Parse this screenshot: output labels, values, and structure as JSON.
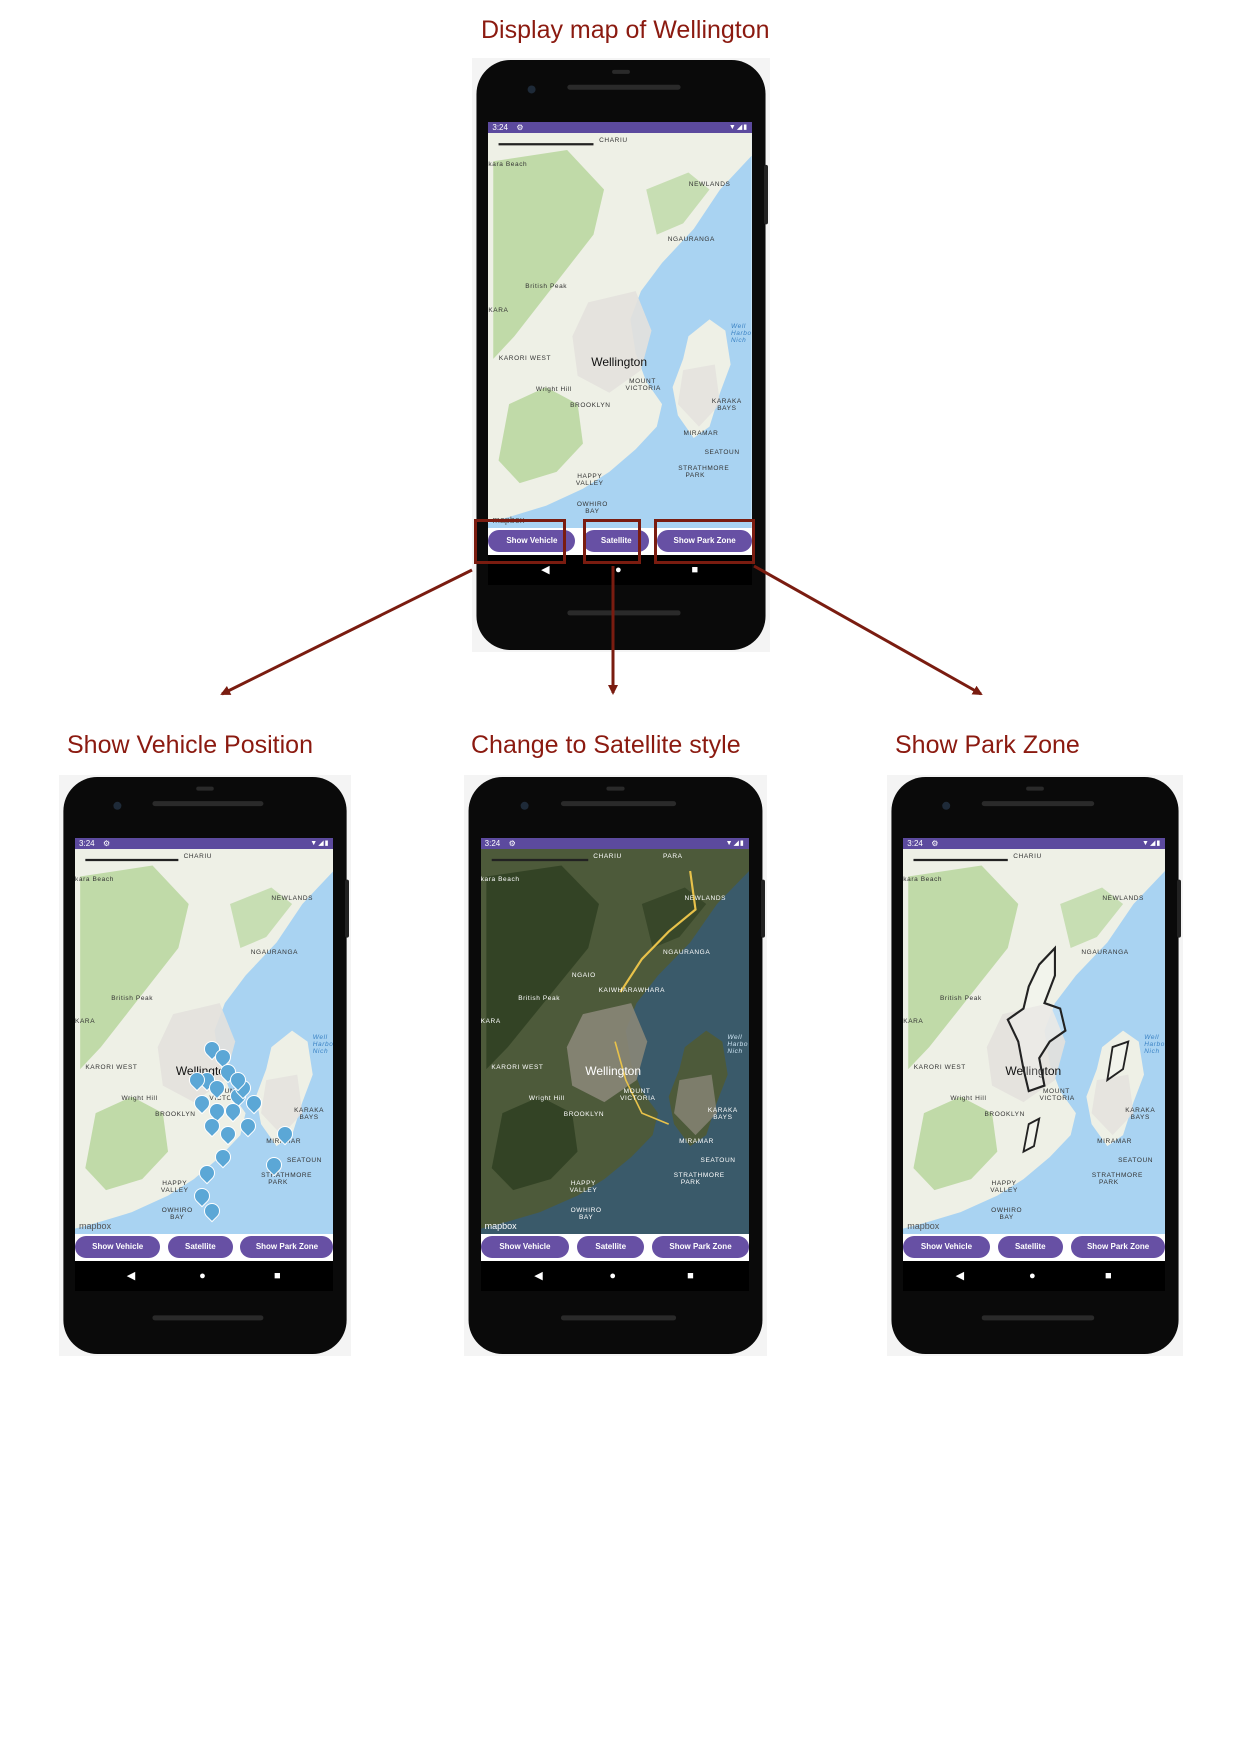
{
  "captions": {
    "main": "Display map of Wellington",
    "vehicle": "Show Vehicle Position",
    "satellite": "Change to Satellite style",
    "parkzone": "Show Park Zone"
  },
  "phone": {
    "status_time": "3:24",
    "map_labels": {
      "city": "Wellington",
      "newlands": "NEWLANDS",
      "ngauranga": "NGAURANGA",
      "karori_west": "KARORI WEST",
      "mount_victoria": "MOUNT VICTORIA",
      "brooklyn": "BROOKLYN",
      "karaka_bays": "KARAKA BAYS",
      "miramar": "MIRAMAR",
      "seatoun": "SEATOUN",
      "strathmore_park": "STRATHMORE PARK",
      "happy_valley": "HAPPY VALLEY",
      "owhiro_bay": "OWHIRO BAY",
      "british_peak": "British Peak",
      "wright_hill": "Wright Hill",
      "kara_beach": "kara Beach",
      "chariu": "CHARIU",
      "kara": "KARA",
      "harbour": "Well Harbo Nich",
      "ngaio": "NGAIO",
      "kaiwharawhara": "KAIWHARAWHARA",
      "para": "PARA"
    },
    "watermark": "mapbox",
    "buttons": {
      "show_vehicle": "Show Vehicle",
      "satellite": "Satellite",
      "show_park_zone": "Show Park Zone"
    }
  },
  "colors": {
    "caption": "#8b1a10",
    "button": "#6750a4",
    "statusbar": "#5c4a9e",
    "water": "#a9d3f2",
    "land": "#eef0e6",
    "vegetation": "#b7d69c",
    "vehicle_marker": "#5ba7d6"
  }
}
